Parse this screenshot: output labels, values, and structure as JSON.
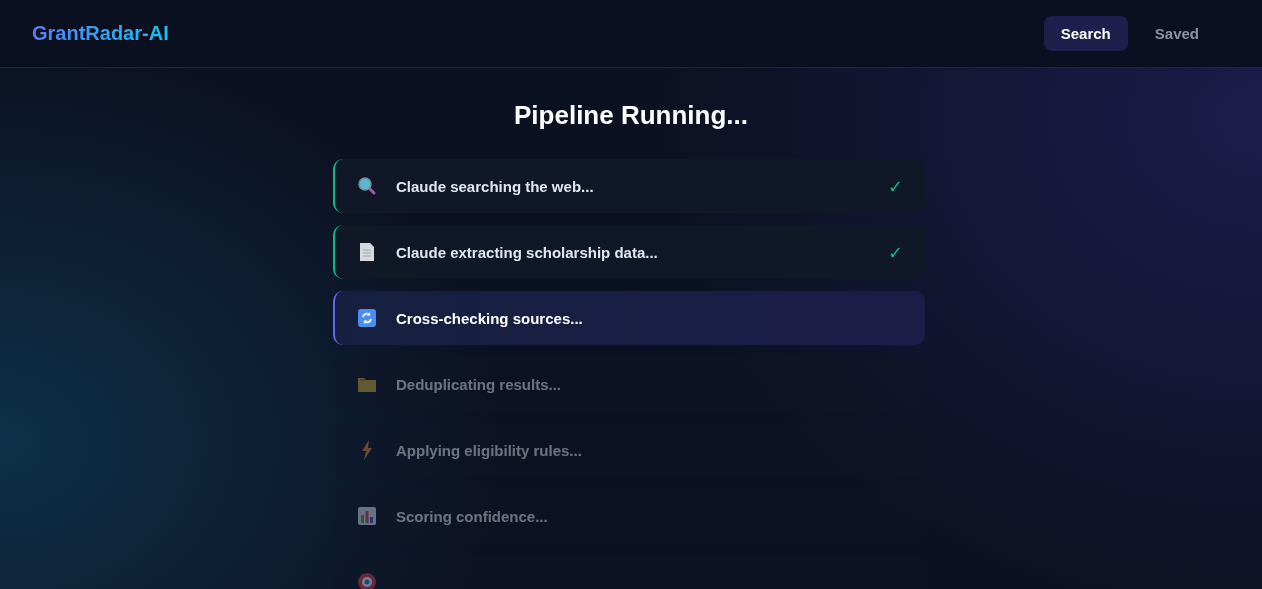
{
  "header": {
    "logo": "GrantRadar-AI",
    "nav": [
      {
        "label": "Search",
        "selected": true
      },
      {
        "label": "Saved",
        "selected": false
      }
    ]
  },
  "title": "Pipeline Running...",
  "steps": [
    {
      "label": "Claude searching the web...",
      "done": true,
      "active": false,
      "check": "✓"
    },
    {
      "label": "Claude extracting scholarship data...",
      "done": true,
      "active": false,
      "check": "✓"
    },
    {
      "label": "Cross-checking sources...",
      "done": false,
      "active": true
    },
    {
      "label": "Deduplicating results...",
      "done": false,
      "active": false
    },
    {
      "label": "Applying eligibility rules...",
      "done": false,
      "active": false
    },
    {
      "label": "Scoring confidence...",
      "done": false,
      "active": false
    },
    {
      "done": false,
      "active": false
    }
  ]
}
